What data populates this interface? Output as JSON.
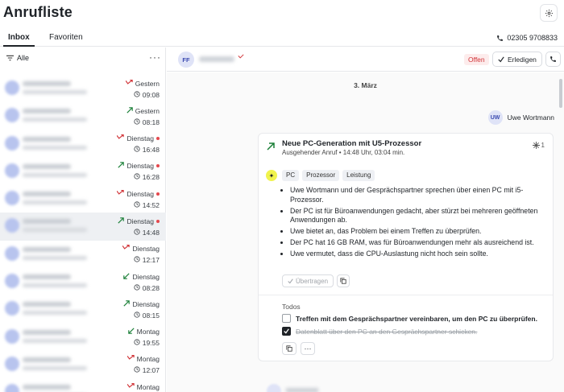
{
  "app": {
    "title": "Anrufliste"
  },
  "tabs": [
    {
      "label": "Inbox"
    },
    {
      "label": "Favoriten"
    }
  ],
  "header": {
    "phone": "02305 9708833"
  },
  "filter": {
    "label": "Alle"
  },
  "calls": [
    {
      "day": "Gestern",
      "time": "09:08",
      "direction": "missed",
      "unread": false
    },
    {
      "day": "Gestern",
      "time": "08:18",
      "direction": "outgoing",
      "unread": false
    },
    {
      "day": "Dienstag",
      "time": "16:48",
      "direction": "missed",
      "unread": true
    },
    {
      "day": "Dienstag",
      "time": "16:28",
      "direction": "outgoing",
      "unread": true
    },
    {
      "day": "Dienstag",
      "time": "14:52",
      "direction": "missed",
      "unread": true
    },
    {
      "day": "Dienstag",
      "time": "14:48",
      "direction": "outgoing",
      "unread": true
    },
    {
      "day": "Dienstag",
      "time": "12:17",
      "direction": "missed",
      "unread": false
    },
    {
      "day": "Dienstag",
      "time": "08:28",
      "direction": "incoming",
      "unread": false
    },
    {
      "day": "Dienstag",
      "time": "08:15",
      "direction": "outgoing",
      "unread": false
    },
    {
      "day": "Montag",
      "time": "19:55",
      "direction": "incoming",
      "unread": false
    },
    {
      "day": "Montag",
      "time": "12:07",
      "direction": "missed",
      "unread": false
    },
    {
      "day": "Montag",
      "time": "",
      "direction": "missed",
      "unread": false
    }
  ],
  "conversation": {
    "contact_initials": "FF",
    "status": "Offen",
    "done_label": "Erledigen",
    "date": "3. März",
    "user": {
      "initials": "UW",
      "name": "Uwe Wortmann"
    },
    "card": {
      "title": "Neue PC-Generation mit U5-Prozessor",
      "subtitle": "Ausgehender Anruf • 14:48 Uhr, 03:04 min.",
      "ai_count": "1",
      "tags": [
        "PC",
        "Prozessor",
        "Leistung"
      ],
      "summary": [
        "Uwe Wortmann und der Gesprächspartner sprechen über einen PC mit i5-Prozessor.",
        "Der PC ist für Büroanwendungen gedacht, aber stürzt bei mehreren geöffneten Anwendungen ab.",
        "Uwe bietet an, das Problem bei einem Treffen zu überprüfen.",
        "Der PC hat 16 GB RAM, was für Büroanwendungen mehr als ausreichend ist.",
        "Uwe vermutet, dass die CPU-Auslastung nicht hoch sein sollte."
      ],
      "transfer_label": "Übertragen",
      "todos_label": "Todos",
      "todos": [
        {
          "text": "Treffen mit dem Gesprächspartner vereinbaren, um den PC zu überprüfen.",
          "done": false
        },
        {
          "text": "Datenblatt über den PC an den Gesprächspartner schicken.",
          "done": true
        }
      ],
      "more_label": "···"
    }
  },
  "colors": {
    "missed": "#d13438",
    "outgoing": "#1a7f37",
    "unread": "#e5484d",
    "accent_tag": "#f0f34d"
  }
}
